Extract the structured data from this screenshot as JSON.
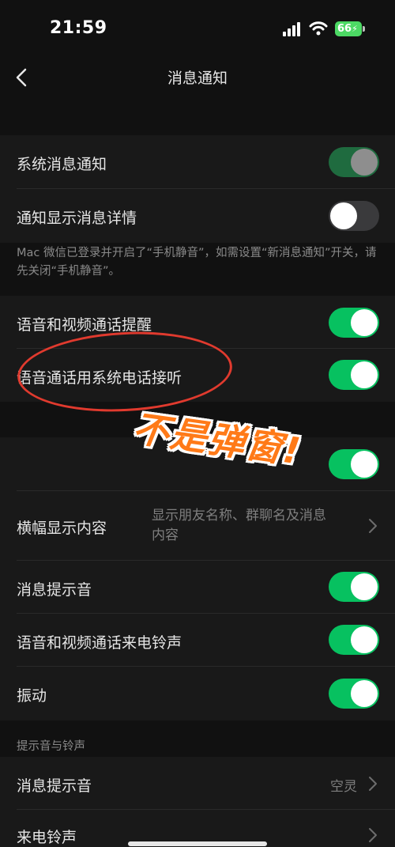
{
  "status": {
    "time": "21:59",
    "battery": "66"
  },
  "nav": {
    "title": "消息通知"
  },
  "group1": {
    "system_notify": "系统消息通知",
    "show_details": "通知显示消息详情"
  },
  "note": "Mac 微信已登录并开启了“手机静音”，如需设置“新消息通知”开关，请先关闭“手机静音”。",
  "group2": {
    "call_reminder": "语音和视频通话提醒",
    "system_phone": "语音通话用系统电话接听"
  },
  "annotation": "不是弹窗!",
  "group3": {
    "banner_label": "横幅显示内容",
    "banner_value_line1": "显示朋友名称、群聊名及消息",
    "banner_value_line2": "内容",
    "message_sound": "消息提示音",
    "call_ringtone": "语音和视频通话来电铃声",
    "vibrate": "振动"
  },
  "sounds_section": {
    "header": "提示音与铃声",
    "message_sound": "消息提示音",
    "message_sound_value": "空灵",
    "ringtone": "来电铃声"
  },
  "toggles": {
    "system_notify": "on-dimmed",
    "show_details": "off",
    "call_reminder": "on",
    "system_phone": "on",
    "hidden_row": "on",
    "message_sound": "on",
    "call_ringtone": "on",
    "vibrate": "on"
  },
  "colors": {
    "accent": "#07c160",
    "annotation_circle": "#e03a2e",
    "annotation_text": "#ff7a18"
  }
}
